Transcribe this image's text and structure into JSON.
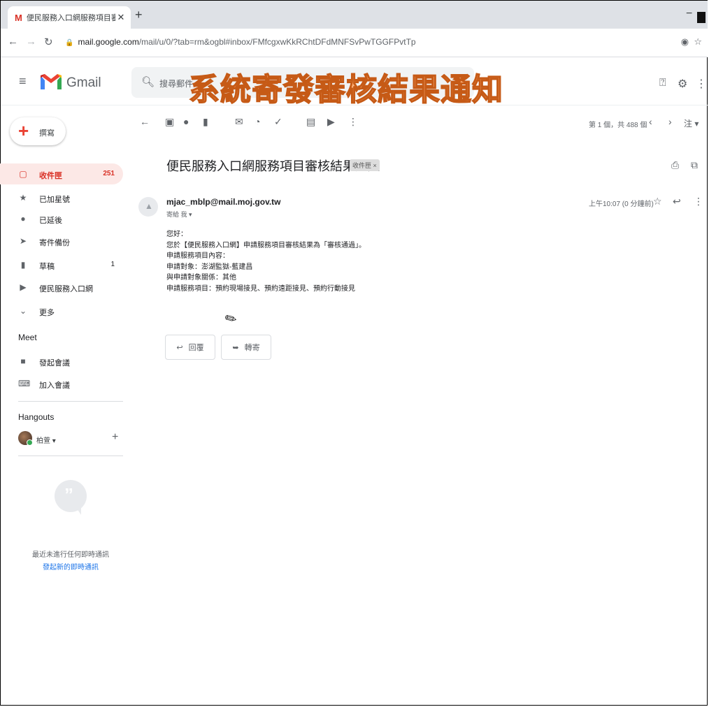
{
  "browser": {
    "tab_title": "便民服務入口網服務項目審核結",
    "tab_close": "✕",
    "new_tab": "+",
    "minimize": "−",
    "url_host": "mail.google.com",
    "url_path": "/mail/u/0/?tab=rm&ogbl#inbox/FMfcgxwKkRChtDFdMNFSvPwTGGFPvtTp"
  },
  "header": {
    "app_name": "Gmail",
    "search_placeholder": "搜尋郵件",
    "overlay_caption": "系統寄發審核結果通知"
  },
  "sidebar": {
    "compose_label": "撰寫",
    "items": [
      {
        "label": "收件匣",
        "count": "251",
        "icon": "inbox-icon"
      },
      {
        "label": "已加星號",
        "count": "",
        "icon": "star-icon"
      },
      {
        "label": "已延後",
        "count": "",
        "icon": "clock-icon"
      },
      {
        "label": "寄件備份",
        "count": "",
        "icon": "send-icon"
      },
      {
        "label": "草稿",
        "count": "1",
        "icon": "draft-icon"
      },
      {
        "label": "便民服務入口網",
        "count": "",
        "icon": "label-icon"
      },
      {
        "label": "更多",
        "count": "",
        "icon": "chevron-down-icon"
      }
    ],
    "meet_title": "Meet",
    "meet_items": [
      {
        "label": "發起會議",
        "icon": "video-icon"
      },
      {
        "label": "加入會議",
        "icon": "keyboard-icon"
      }
    ],
    "hangouts_title": "Hangouts",
    "hangouts_user": "柏萱 ▾",
    "no_chats": "最近未進行任何即時通訊",
    "start_chat": "發起新的即時通訊"
  },
  "toolbar": {
    "pager": "第 1 個，共 488 個",
    "label_more": "注 ▾"
  },
  "message": {
    "subject": "便民服務入口網服務項目審核結果通知",
    "label_chip": "收件匣 ×",
    "sender": "mjac_mblp@mail.moj.gov.tw",
    "to_me": "寄給 我 ▾",
    "time": "上午10:07 (0 分鐘前)",
    "body_lines": [
      "您好：",
      "您於【便民服務入口網】申請服務項目審核結果為「審核通過」。",
      "申請服務項目內容：",
      "申請對象：澎湖監獄-藍建昌",
      "與申請對象關係：其他",
      "申請服務項目：預約現場接見、預約遠距接見、預約行動接見"
    ],
    "reply_label": "回覆",
    "forward_label": "轉寄"
  },
  "colors": {
    "gmail_red": "#ea4335",
    "active_bg": "#fce8e6",
    "overlay_fill": "#ffb27a",
    "overlay_stroke": "#c65a16"
  }
}
